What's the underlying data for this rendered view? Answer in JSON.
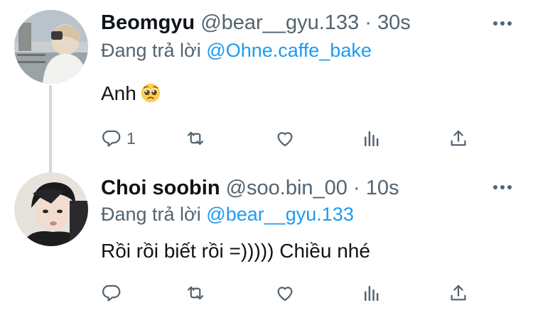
{
  "tweets": [
    {
      "display_name": "Beomgyu",
      "handle": "@bear__gyu.133",
      "separator": "·",
      "time": "30s",
      "reply_prefix": "Đang trả lời",
      "reply_to": "@Ohne.caffe_bake",
      "text": "Anh",
      "emoji": "pleading-face-emoji",
      "reply_count": "1",
      "retweet_count": "",
      "like_count": ""
    },
    {
      "display_name": "Choi soobin",
      "handle": "@soo.bin_00",
      "separator": "·",
      "time": "10s",
      "reply_prefix": "Đang trả lời",
      "reply_to": "@bear__gyu.133",
      "text": "Rồi rồi biết rồi =))))) Chiều nhé",
      "reply_count": "",
      "retweet_count": "",
      "like_count": ""
    }
  ],
  "colors": {
    "text": "#0f1419",
    "secondary": "#536471",
    "link": "#1d9bf0",
    "thread_line": "#cfd9de"
  },
  "icons": [
    "reply-icon",
    "retweet-icon",
    "like-icon",
    "analytics-icon",
    "share-icon",
    "more-icon"
  ]
}
